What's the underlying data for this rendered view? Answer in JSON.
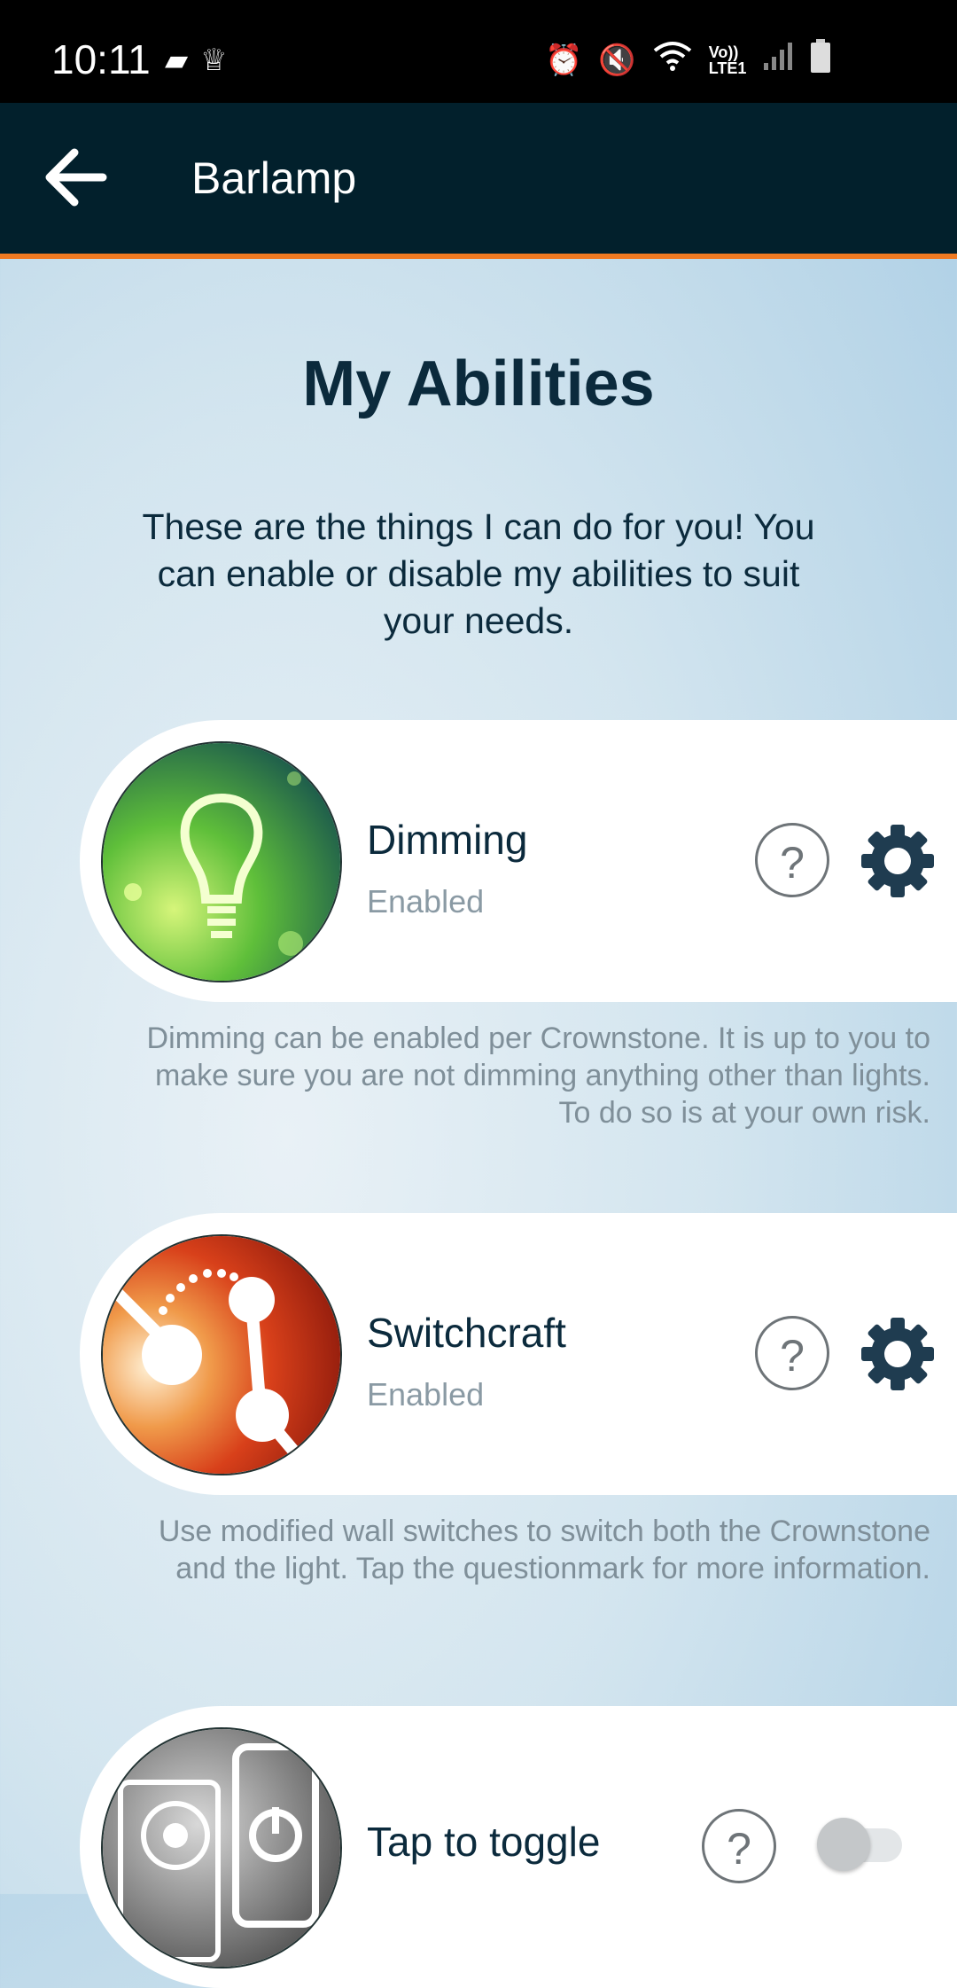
{
  "status_bar": {
    "time": "10:11",
    "icons": [
      "app-icon",
      "crown-icon",
      "alarm-icon",
      "mute-icon",
      "wifi-icon",
      "volte-icon",
      "signal-icon",
      "battery-icon"
    ],
    "volte_label": "Vo))\nLTE1"
  },
  "app_bar": {
    "back_icon": "arrow-left-icon",
    "title": "Barlamp",
    "accent_color": "#f07a22",
    "background_color": "#02202c"
  },
  "page": {
    "heading": "My Abilities",
    "intro": "These are the things I can do for you! You can enable or disable my abilities to suit your needs."
  },
  "abilities": [
    {
      "name": "Dimming",
      "state": "Enabled",
      "icon": "lightbulb-icon",
      "description": "Dimming can be enabled per Crownstone. It is up to you to make sure you are not dimming anything other than lights. To do so is at your own risk.",
      "control": "settings"
    },
    {
      "name": "Switchcraft",
      "state": "Enabled",
      "icon": "switchcraft-icon",
      "description": "Use modified wall switches to switch both the Crownstone and the light. Tap the questionmark for more information.",
      "control": "settings"
    },
    {
      "name": "Tap to toggle",
      "state": "",
      "icon": "tap-to-toggle-icon",
      "control": "toggle",
      "toggle_on": false
    }
  ],
  "help_label": "?"
}
